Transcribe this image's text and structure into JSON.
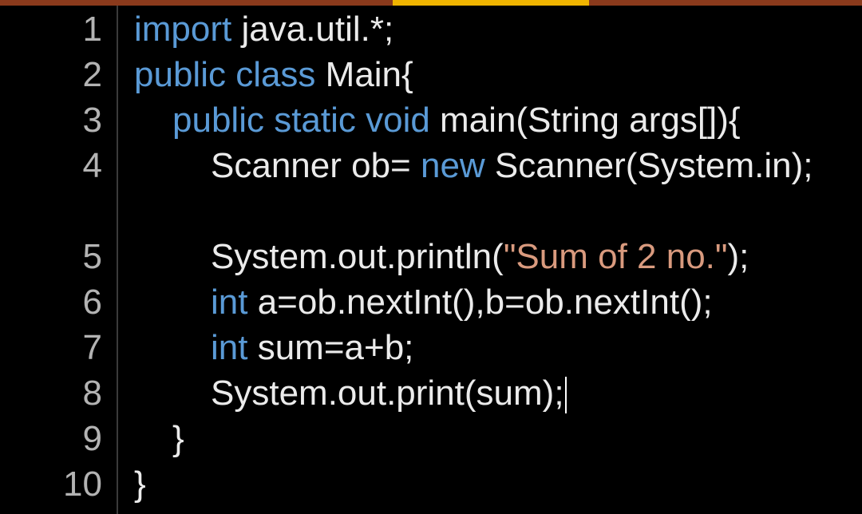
{
  "editor": {
    "accent_color": "#f0b400",
    "topbar_color": "#8a3a1c",
    "keyword_color": "#5a9ad6",
    "string_color": "#d99a7e",
    "lines": [
      {
        "num": "1",
        "parts": [
          "import",
          " java.util.*;"
        ]
      },
      {
        "num": "2",
        "parts": [
          "public class",
          " Main{"
        ]
      },
      {
        "num": "3",
        "parts": [
          "public static void",
          " main(String args[]){"
        ]
      },
      {
        "num": "4",
        "parts": [
          "Scanner ob= ",
          "new",
          " Scanner(System.in);"
        ]
      },
      {
        "num": "5",
        "parts": [
          "System.out.println(",
          "\"Sum of 2 no.\"",
          ");"
        ]
      },
      {
        "num": "6",
        "parts": [
          "int",
          " a=ob.nextInt(),b=ob.nextInt();"
        ]
      },
      {
        "num": "7",
        "parts": [
          "int",
          " sum=a+b;"
        ]
      },
      {
        "num": "8",
        "parts": [
          "System.out.print(sum);"
        ]
      },
      {
        "num": "9",
        "parts": [
          "}"
        ]
      },
      {
        "num": "10",
        "parts": [
          "}"
        ]
      }
    ]
  }
}
